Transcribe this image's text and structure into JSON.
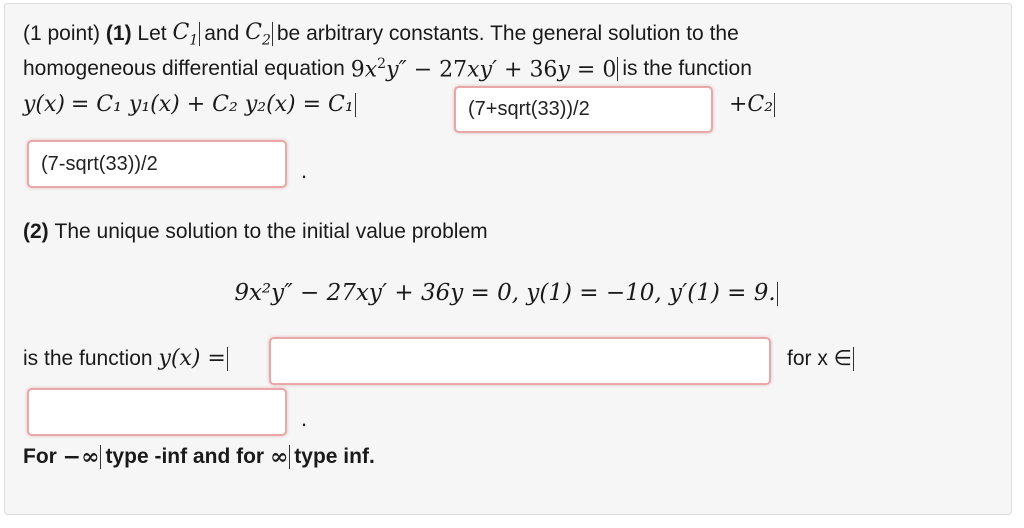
{
  "part1": {
    "points": "(1 point)",
    "label": "(1)",
    "text_let": "Let",
    "c1": "C",
    "c1_sub": "1",
    "text_and": "and",
    "c2": "C",
    "c2_sub": "2",
    "text_be": "be arbitrary constants. The general solution to the",
    "text_homog": "homogeneous differential equation",
    "eq_coef1": "9",
    "eq_x": "x",
    "eq_x_exp": "2",
    "eq_ypp": "y″",
    "eq_minus": "−",
    "eq_27": "27",
    "eq_xyp": "xy′",
    "eq_plus": "+",
    "eq_36": "36",
    "eq_y": "y",
    "eq_eq": "=",
    "eq_zero": "0",
    "text_is_function": "is the function",
    "gen_sol_lhs": "y(x)",
    "gen_sol_mid": "= C₁ y₁(x) + C₂ y₂(x) = C₁",
    "plus_c2": "+C₂",
    "answer1_value": "(7+sqrt(33))/2",
    "answer2_value": "(7-sqrt(33))/2",
    "period": "."
  },
  "part2": {
    "label": "(2)",
    "text": "The unique solution to the initial value problem",
    "ivp_equation": "9x²y″ − 27xy′ + 36y = 0,   y(1) = −10,   y′(1) = 9.",
    "is_function": "is the function",
    "yx_eq": "y(x) =",
    "for_x_in": "for x ∈",
    "answer3_value": "",
    "answer4_value": "",
    "period": "."
  },
  "note": {
    "for": "For",
    "neg_inf": "−∞",
    "type_neg": "type -inf and for",
    "pos_inf": "∞",
    "type_pos": "type inf."
  }
}
